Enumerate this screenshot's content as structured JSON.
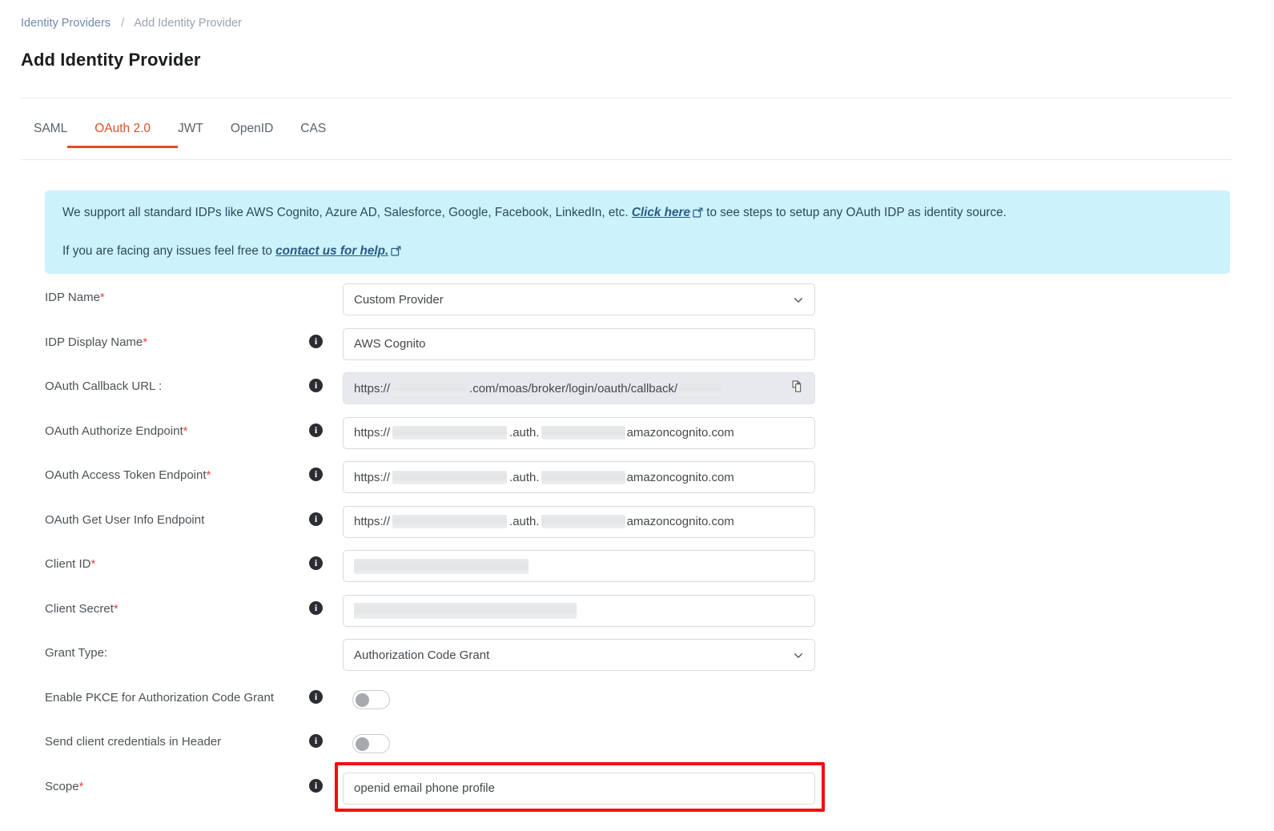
{
  "breadcrumb": {
    "parent": "Identity Providers",
    "separator": "/",
    "current": "Add Identity Provider"
  },
  "page": {
    "title": "Add Identity Provider"
  },
  "tabs": {
    "items": [
      {
        "label": "SAML",
        "active": false
      },
      {
        "label": "OAuth 2.0",
        "active": true
      },
      {
        "label": "JWT",
        "active": false
      },
      {
        "label": "OpenID",
        "active": false
      },
      {
        "label": "CAS",
        "active": false
      }
    ],
    "active_color": "#dd5026"
  },
  "banner": {
    "background": "#ccf2fb",
    "line1_before": "We support all standard IDPs like AWS Cognito, Azure AD, Salesforce, Google, Facebook, LinkedIn, etc. ",
    "line1_link": "Click here",
    "line1_after": " to see steps to setup any OAuth IDP as identity source.",
    "line2_before": "If you are facing any issues feel free to ",
    "line2_link": "contact us for help.",
    "line2_after": "",
    "link_icon": "external-link-icon"
  },
  "form": {
    "idp_name": {
      "label": "IDP Name",
      "required": true,
      "value": "Custom Provider",
      "control": "select",
      "has_info": false
    },
    "idp_display_name": {
      "label": "IDP Display Name",
      "required": true,
      "value": "AWS Cognito",
      "control": "text",
      "has_info": true
    },
    "oauth_callback_url": {
      "label": "OAuth Callback URL :",
      "required": false,
      "control": "readonly",
      "has_info": true,
      "prefix": "https://",
      "middle": ".com/moas/broker/login/oauth/callback/",
      "suffix": "",
      "redacted": true,
      "copy_icon": "copy-icon"
    },
    "oauth_authorize_endpoint": {
      "label": "OAuth Authorize Endpoint",
      "required": true,
      "control": "text",
      "has_info": true,
      "prefix": "https://",
      "middle": ".auth.",
      "suffix": "amazoncognito.com",
      "redacted": true
    },
    "oauth_access_token_endpoint": {
      "label": "OAuth Access Token Endpoint",
      "required": true,
      "control": "text",
      "has_info": true,
      "prefix": "https://",
      "middle": ".auth.",
      "suffix": "amazoncognito.com",
      "redacted": true
    },
    "oauth_get_user_info_endpoint": {
      "label": "OAuth Get User Info Endpoint",
      "required": false,
      "control": "text",
      "has_info": true,
      "prefix": "https://",
      "middle": ".auth.",
      "suffix": "amazoncognito.com",
      "redacted": true
    },
    "client_id": {
      "label": "Client ID",
      "required": true,
      "control": "text",
      "has_info": true,
      "value": "",
      "redacted": true
    },
    "client_secret": {
      "label": "Client Secret",
      "required": true,
      "control": "text",
      "has_info": true,
      "value": "",
      "redacted": true
    },
    "grant_type": {
      "label": "Grant Type:",
      "required": false,
      "control": "select",
      "has_info": false,
      "value": "Authorization Code Grant"
    },
    "enable_pkce": {
      "label": "Enable PKCE for Authorization Code Grant",
      "required": false,
      "control": "toggle",
      "has_info": true,
      "value": "off"
    },
    "send_client_credentials_header": {
      "label": "Send client credentials in Header",
      "required": false,
      "control": "toggle",
      "has_info": true,
      "value": "off"
    },
    "scope": {
      "label": "Scope",
      "required": true,
      "control": "text",
      "has_info": true,
      "value": "openid email phone profile",
      "highlighted": true,
      "highlight_color": "#f50d0d"
    }
  }
}
